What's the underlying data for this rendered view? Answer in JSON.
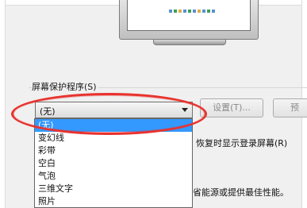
{
  "screensaver": {
    "section_label": "屏幕保护程序(S)",
    "combo_value": "(无)",
    "settings_button": "设置(T)...",
    "preview_button": "预",
    "checkbox_label": "恢复时显示登录屏幕(R)",
    "power_text": "省能源或提供最佳性能。",
    "options": [
      "(无)",
      "变幻线",
      "彩带",
      "空白",
      "气泡",
      "三维文字",
      "照片"
    ],
    "selected_index": 0
  },
  "colors": {
    "highlight": "#3399ff",
    "annotation": "#e8322d"
  }
}
